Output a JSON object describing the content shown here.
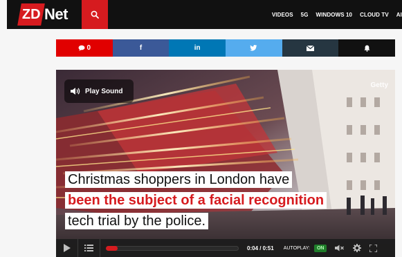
{
  "header": {
    "logo_mark": "ZD",
    "logo_text": "Net",
    "nav": [
      "VIDEOS",
      "5G",
      "WINDOWS 10",
      "CLOUD TV",
      "AI"
    ]
  },
  "share_bar": {
    "comments_count": "0",
    "items": [
      "comments",
      "facebook",
      "linkedin",
      "twitter",
      "email",
      "notifications"
    ],
    "icons": {
      "facebook": "f",
      "linkedin": "in"
    }
  },
  "video": {
    "play_sound_label": "Play Sound",
    "credit": "Getty",
    "caption": {
      "line1": "Christmas shoppers in London have",
      "line2": "been the subject of a facial recognition",
      "line3": "tech trial by the police."
    },
    "controls": {
      "time": "0:04 / 0:51",
      "autoplay_label": "AUTOPLAY:",
      "autoplay_state": "ON",
      "progress_fraction": 0.09
    }
  },
  "colors": {
    "brand_red": "#d61b1f",
    "facebook": "#3b5998",
    "linkedin": "#0077b5",
    "twitter": "#55acee",
    "email": "#263641",
    "bell": "#111111"
  }
}
